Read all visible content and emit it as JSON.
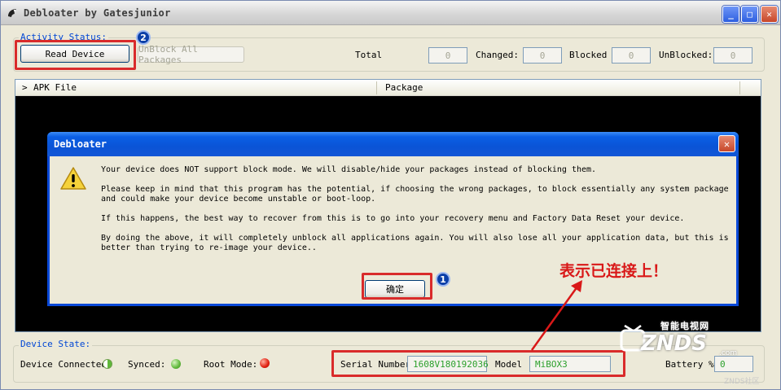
{
  "window": {
    "title": "Debloater by Gatesjunior",
    "controls": {
      "minimize": "_",
      "maximize": "□",
      "close": "✕"
    }
  },
  "activity": {
    "label": "Activity Status:",
    "read_device": "Read Device",
    "unblock_all": "UnBlock All Packages",
    "total_label": "Total",
    "total_value": "0",
    "changed_label": "Changed:",
    "changed_value": "0",
    "blocked_label": "Blocked",
    "blocked_value": "0",
    "unblocked_label": "UnBlocked:",
    "unblocked_value": "0"
  },
  "list": {
    "columns": [
      "APK File",
      "Package"
    ]
  },
  "dialog": {
    "title": "Debloater",
    "line1": "Your device does NOT support block mode.  We will disable/hide your packages instead of blocking them.",
    "line2a": "Please keep in mind that this program has the potential, if choosing the wrong packages, to block essentially any system package",
    "line2b": "and could make your device become unstable or boot-loop.",
    "line3": "If this happens, the best way to recover from this is to go into your recovery menu and Factory Data Reset your device.",
    "line4a": "By doing the above, it will completely unblock all applications again.  You will also lose all your application data, but this is",
    "line4b": "better than trying to re-image your device..",
    "ok": "确定"
  },
  "device_state": {
    "label": "Device State:",
    "connected_label": "Device Connected:",
    "synced_label": "Synced:",
    "root_label": "Root Mode:",
    "serial_label": "Serial Number:",
    "serial_value": "1608V180192036",
    "model_label": "Model",
    "model_value": "MiBOX3",
    "battery_label": "Battery %:",
    "battery_value": "0"
  },
  "annotations": {
    "badge1": "1",
    "badge2": "2",
    "connected_note": "表示已连接上！"
  },
  "watermark": {
    "cn": "智能电视网",
    "brand": "ZNDS",
    "com": ".com",
    "site": "ZNDS社区"
  },
  "colors": {
    "annotation_red": "#D92B2B",
    "dialog_blue": "#0A49D8",
    "value_green": "#2CA02C"
  }
}
